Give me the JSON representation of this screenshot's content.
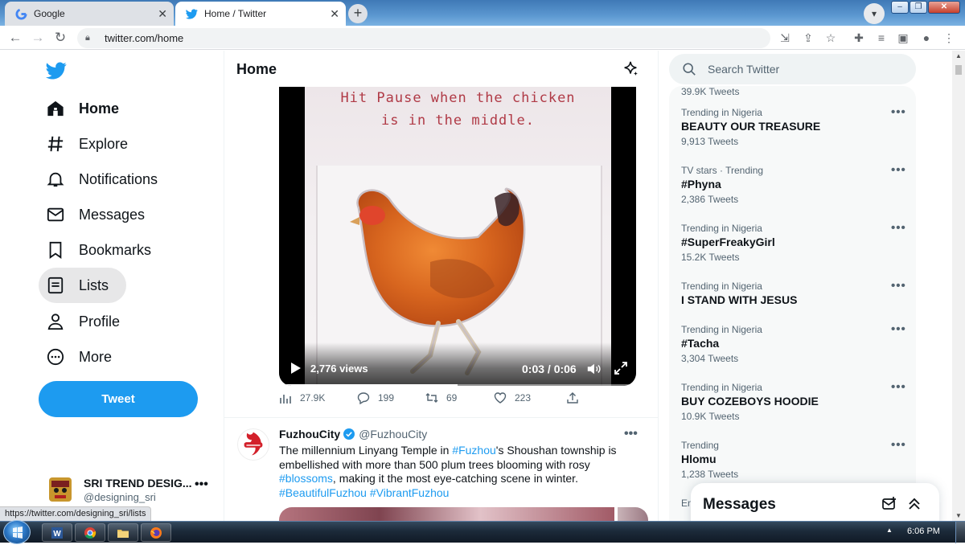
{
  "browser": {
    "tabs": [
      {
        "label": "Google",
        "favicon": "google-icon"
      },
      {
        "label": "Home / Twitter",
        "favicon": "twitter-bird-icon"
      }
    ],
    "new_tab": "+",
    "url": "twitter.com/home",
    "status_url": "https://twitter.com/designing_sri/lists"
  },
  "nav": {
    "items": [
      {
        "label": "Home",
        "icon": "home-icon"
      },
      {
        "label": "Explore",
        "icon": "hashtag-icon"
      },
      {
        "label": "Notifications",
        "icon": "bell-icon"
      },
      {
        "label": "Messages",
        "icon": "envelope-icon"
      },
      {
        "label": "Bookmarks",
        "icon": "bookmark-icon"
      },
      {
        "label": "Lists",
        "icon": "lists-icon"
      },
      {
        "label": "Profile",
        "icon": "person-icon"
      },
      {
        "label": "More",
        "icon": "more-circle-icon"
      }
    ],
    "tweet_button": "Tweet",
    "account": {
      "name": "SRI TREND DESIG...",
      "handle": "@designing_sri",
      "more": "•••"
    }
  },
  "timeline": {
    "title": "Home",
    "video": {
      "caption_line1": "Hit Pause when the chicken",
      "caption_line2": "is in the middle.",
      "views": "2,776 views",
      "time": "0:03 / 0:06",
      "progress": 0.5
    },
    "actions": {
      "analytics": "27.9K",
      "replies": "199",
      "retweets": "69",
      "likes": "223"
    },
    "tweet2": {
      "name": "FuzhouCity",
      "handle": "@FuzhouCity",
      "more": "•••",
      "text_parts": [
        {
          "t": "The millennium Linyang Temple in "
        },
        {
          "t": "#Fuzhou",
          "tag": true
        },
        {
          "t": "'s Shoushan township is embellished with more than 500 plum trees blooming with rosy "
        },
        {
          "t": "#blossoms",
          "tag": true
        },
        {
          "t": ", making it the most eye-catching scene in winter. "
        },
        {
          "t": "#BeautifulFuzhou",
          "tag": true
        },
        {
          "t": " "
        },
        {
          "t": "#VibrantFuzhou",
          "tag": true
        }
      ]
    }
  },
  "sidebar": {
    "search_placeholder": "Search Twitter",
    "top_count": "39.9K Tweets",
    "trends": [
      {
        "context": "Trending in Nigeria",
        "title": "BEAUTY OUR TREASURE",
        "count": "9,913 Tweets"
      },
      {
        "context": "TV stars · Trending",
        "title": "#Phyna",
        "count": "2,386 Tweets"
      },
      {
        "context": "Trending in Nigeria",
        "title": "#SuperFreakyGirl",
        "count": "15.2K Tweets"
      },
      {
        "context": "Trending in Nigeria",
        "title": "I STAND WITH JESUS",
        "count": ""
      },
      {
        "context": "Trending in Nigeria",
        "title": "#Tacha",
        "count": "3,304 Tweets"
      },
      {
        "context": "Trending in Nigeria",
        "title": "BUY COZEBOYS HOODIE",
        "count": "10.9K Tweets"
      },
      {
        "context": "Trending",
        "title": "Hlomu",
        "count": "1,238 Tweets"
      },
      {
        "context": "En",
        "title": "",
        "count": ""
      }
    ],
    "trend_more": "•••",
    "messages_title": "Messages"
  },
  "taskbar": {
    "apps": [
      "word-icon",
      "chrome-icon",
      "folder-icon",
      "firefox-icon"
    ],
    "clock": "6:06 PM"
  },
  "colors": {
    "accent": "#1d9bf0",
    "text": "#0f1419",
    "muted": "#536471"
  }
}
